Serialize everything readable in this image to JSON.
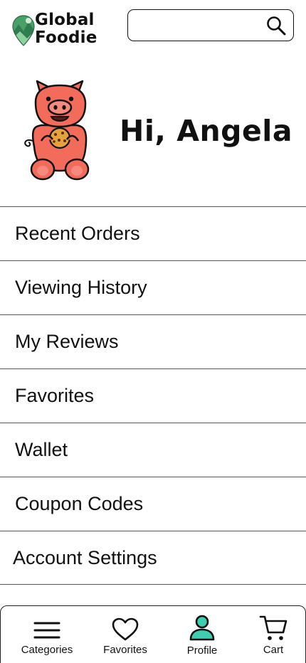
{
  "header": {
    "logo": {
      "line1": "Global",
      "line2": "Foodie"
    },
    "search": {
      "placeholder": "",
      "value": "",
      "icon": "search-icon"
    }
  },
  "profile": {
    "greeting": "Hi, Angela",
    "avatar": "pig-mascot-eating-cookie"
  },
  "menu": {
    "items": [
      {
        "label": "Recent Orders"
      },
      {
        "label": "Viewing History"
      },
      {
        "label": "My Reviews"
      },
      {
        "label": "Favorites"
      },
      {
        "label": "Wallet"
      },
      {
        "label": "Coupon Codes"
      },
      {
        "label": "Account Settings"
      }
    ]
  },
  "bottom_nav": {
    "items": [
      {
        "label": "Categories",
        "icon": "menu-icon"
      },
      {
        "label": "Favorites",
        "icon": "heart-icon"
      },
      {
        "label": "Profile",
        "icon": "person-icon",
        "active": true
      },
      {
        "label": "Cart",
        "icon": "cart-icon"
      }
    ]
  },
  "colors": {
    "profile_active": "#3dcfb0",
    "pig_pink": "#f26b5b",
    "logo_green": "#3a9a5c",
    "text": "#111111"
  }
}
